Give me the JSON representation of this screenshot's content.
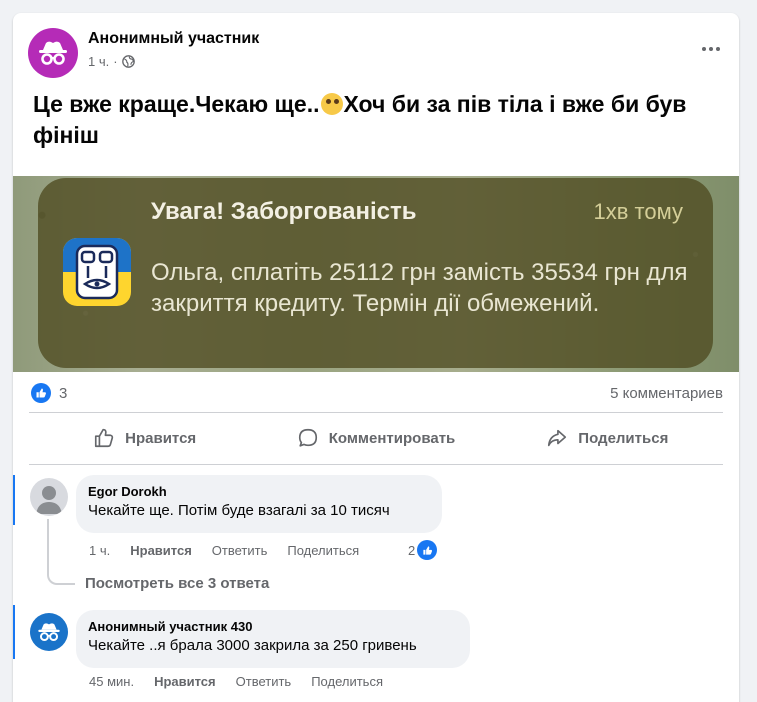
{
  "post": {
    "author": "Анонимный участник",
    "time": "1 ч.",
    "separator": "·",
    "text_part1": "Це вже краще.Чекаю ще..",
    "text_part2": "Хоч би за пів тіла і вже би був фініш",
    "emoji_icon": "face-with-monocle-emoji"
  },
  "notification": {
    "title": "Увага! Заборгованість",
    "time": "1хв тому",
    "body": "Ольга, сплатіть 25112 грн замість 35534 грн для закриття кредиту. Термін дії обмежений.",
    "app_icon": "bank-app-icon"
  },
  "stats": {
    "likes": "3",
    "comments": "5 комментариев"
  },
  "actions": {
    "like": "Нравится",
    "comment": "Комментировать",
    "share": "Поделиться"
  },
  "comments": [
    {
      "author": "Egor Dorokh",
      "text": "Чекайте ще. Потім буде взагалі за 10 тисяч",
      "time": "1 ч.",
      "like": "Нравится",
      "reply": "Ответить",
      "share": "Поделиться",
      "reactions": "2"
    },
    {
      "author": "Анонимный участник 430",
      "text": "Чекайте ..я брала 3000 закрила за 250 гривень",
      "time": "45 мин.",
      "like": "Нравится",
      "reply": "Ответить",
      "share": "Поделиться"
    }
  ],
  "view_replies": "Посмотреть все 3 ответа",
  "colors": {
    "brand_blue": "#1877f2",
    "anon_avatar_main": "#b52bb7",
    "anon_avatar_comment": "#1a73c9",
    "notification_bg": "#4e4a20"
  }
}
